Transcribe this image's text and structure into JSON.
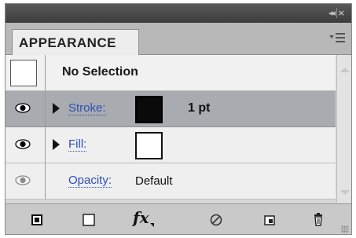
{
  "panel": {
    "title": "APPEARANCE",
    "controls": {
      "collapse": "◂◂",
      "close": "×"
    }
  },
  "rows": {
    "selection": {
      "label": "No Selection"
    },
    "stroke": {
      "label": "Stroke:",
      "weight": "1 pt",
      "color": "#000000"
    },
    "fill": {
      "label": "Fill:",
      "color": "#ffffff"
    },
    "opacity": {
      "label": "Opacity:",
      "value": "Default"
    }
  },
  "toolbar": {
    "fx_label": "fx",
    "icons": [
      "new-art-basic-appearance-icon",
      "clear-appearance-icon",
      "add-effect-icon",
      "reduce-to-basic-icon",
      "duplicate-item-icon",
      "delete-item-icon"
    ]
  },
  "colors": {
    "link": "#2c4fb8",
    "selected_row": "#a8acb0"
  }
}
